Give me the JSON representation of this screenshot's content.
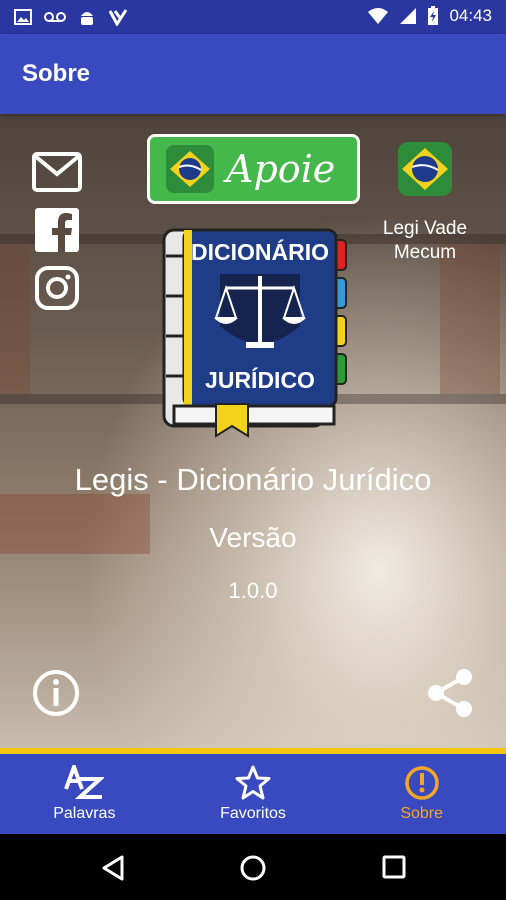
{
  "status_bar": {
    "time": "04:43",
    "icons": [
      "image-icon",
      "voicemail-icon",
      "android-icon",
      "check-icon",
      "wifi-icon",
      "signal-icon",
      "battery-charging-icon"
    ]
  },
  "app_bar": {
    "title": "Sobre"
  },
  "social": {
    "icons": [
      "email-icon",
      "facebook-icon",
      "instagram-icon"
    ]
  },
  "support": {
    "label": "Apoie"
  },
  "vade": {
    "label_line1": "Legi Vade",
    "label_line2": "Mecum"
  },
  "logo": {
    "line1": "DICIONÁRIO",
    "line2": "JURÍDICO"
  },
  "about": {
    "app_name": "Legis - Dicionário Jurídico",
    "version_label": "Versão",
    "version_value": "1.0.0"
  },
  "bottom_nav": {
    "items": [
      {
        "label": "Palavras",
        "icon": "az-icon",
        "active": false
      },
      {
        "label": "Favoritos",
        "icon": "star-icon",
        "active": false
      },
      {
        "label": "Sobre",
        "icon": "alert-circle-icon",
        "active": true
      }
    ]
  },
  "colors": {
    "primary": "#3949c0",
    "primary_dark": "#2a37a0",
    "accent": "#f5a623",
    "divider": "#f2c811",
    "apoie_green": "#44b84a"
  }
}
